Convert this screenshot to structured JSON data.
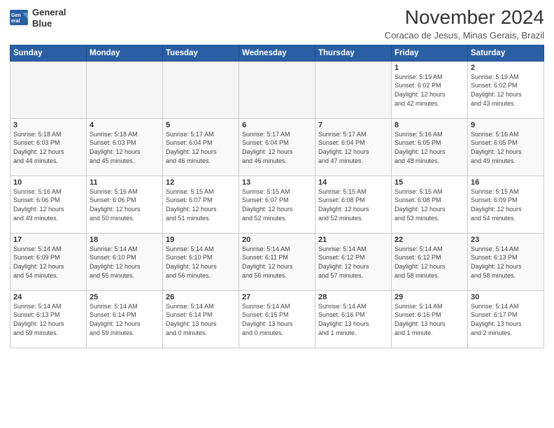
{
  "logo": {
    "line1": "General",
    "line2": "Blue"
  },
  "title": "November 2024",
  "subtitle": "Coracao de Jesus, Minas Gerais, Brazil",
  "days_of_week": [
    "Sunday",
    "Monday",
    "Tuesday",
    "Wednesday",
    "Thursday",
    "Friday",
    "Saturday"
  ],
  "weeks": [
    [
      {
        "day": "",
        "info": ""
      },
      {
        "day": "",
        "info": ""
      },
      {
        "day": "",
        "info": ""
      },
      {
        "day": "",
        "info": ""
      },
      {
        "day": "",
        "info": ""
      },
      {
        "day": "1",
        "info": "Sunrise: 5:19 AM\nSunset: 6:02 PM\nDaylight: 12 hours\nand 42 minutes."
      },
      {
        "day": "2",
        "info": "Sunrise: 5:19 AM\nSunset: 6:02 PM\nDaylight: 12 hours\nand 43 minutes."
      }
    ],
    [
      {
        "day": "3",
        "info": "Sunrise: 5:18 AM\nSunset: 6:03 PM\nDaylight: 12 hours\nand 44 minutes."
      },
      {
        "day": "4",
        "info": "Sunrise: 5:18 AM\nSunset: 6:03 PM\nDaylight: 12 hours\nand 45 minutes."
      },
      {
        "day": "5",
        "info": "Sunrise: 5:17 AM\nSunset: 6:04 PM\nDaylight: 12 hours\nand 46 minutes."
      },
      {
        "day": "6",
        "info": "Sunrise: 5:17 AM\nSunset: 6:04 PM\nDaylight: 12 hours\nand 46 minutes."
      },
      {
        "day": "7",
        "info": "Sunrise: 5:17 AM\nSunset: 6:04 PM\nDaylight: 12 hours\nand 47 minutes."
      },
      {
        "day": "8",
        "info": "Sunrise: 5:16 AM\nSunset: 6:05 PM\nDaylight: 12 hours\nand 48 minutes."
      },
      {
        "day": "9",
        "info": "Sunrise: 5:16 AM\nSunset: 6:05 PM\nDaylight: 12 hours\nand 49 minutes."
      }
    ],
    [
      {
        "day": "10",
        "info": "Sunrise: 5:16 AM\nSunset: 6:06 PM\nDaylight: 12 hours\nand 49 minutes."
      },
      {
        "day": "11",
        "info": "Sunrise: 5:16 AM\nSunset: 6:06 PM\nDaylight: 12 hours\nand 50 minutes."
      },
      {
        "day": "12",
        "info": "Sunrise: 5:15 AM\nSunset: 6:07 PM\nDaylight: 12 hours\nand 51 minutes."
      },
      {
        "day": "13",
        "info": "Sunrise: 5:15 AM\nSunset: 6:07 PM\nDaylight: 12 hours\nand 52 minutes."
      },
      {
        "day": "14",
        "info": "Sunrise: 5:15 AM\nSunset: 6:08 PM\nDaylight: 12 hours\nand 52 minutes."
      },
      {
        "day": "15",
        "info": "Sunrise: 5:15 AM\nSunset: 6:08 PM\nDaylight: 12 hours\nand 53 minutes."
      },
      {
        "day": "16",
        "info": "Sunrise: 5:15 AM\nSunset: 6:09 PM\nDaylight: 12 hours\nand 54 minutes."
      }
    ],
    [
      {
        "day": "17",
        "info": "Sunrise: 5:14 AM\nSunset: 6:09 PM\nDaylight: 12 hours\nand 54 minutes."
      },
      {
        "day": "18",
        "info": "Sunrise: 5:14 AM\nSunset: 6:10 PM\nDaylight: 12 hours\nand 55 minutes."
      },
      {
        "day": "19",
        "info": "Sunrise: 5:14 AM\nSunset: 6:10 PM\nDaylight: 12 hours\nand 56 minutes."
      },
      {
        "day": "20",
        "info": "Sunrise: 5:14 AM\nSunset: 6:11 PM\nDaylight: 12 hours\nand 56 minutes."
      },
      {
        "day": "21",
        "info": "Sunrise: 5:14 AM\nSunset: 6:12 PM\nDaylight: 12 hours\nand 57 minutes."
      },
      {
        "day": "22",
        "info": "Sunrise: 5:14 AM\nSunset: 6:12 PM\nDaylight: 12 hours\nand 58 minutes."
      },
      {
        "day": "23",
        "info": "Sunrise: 5:14 AM\nSunset: 6:13 PM\nDaylight: 12 hours\nand 58 minutes."
      }
    ],
    [
      {
        "day": "24",
        "info": "Sunrise: 5:14 AM\nSunset: 6:13 PM\nDaylight: 12 hours\nand 59 minutes."
      },
      {
        "day": "25",
        "info": "Sunrise: 5:14 AM\nSunset: 6:14 PM\nDaylight: 12 hours\nand 59 minutes."
      },
      {
        "day": "26",
        "info": "Sunrise: 5:14 AM\nSunset: 6:14 PM\nDaylight: 13 hours\nand 0 minutes."
      },
      {
        "day": "27",
        "info": "Sunrise: 5:14 AM\nSunset: 6:15 PM\nDaylight: 13 hours\nand 0 minutes."
      },
      {
        "day": "28",
        "info": "Sunrise: 5:14 AM\nSunset: 6:16 PM\nDaylight: 13 hours\nand 1 minute."
      },
      {
        "day": "29",
        "info": "Sunrise: 5:14 AM\nSunset: 6:16 PM\nDaylight: 13 hours\nand 1 minute."
      },
      {
        "day": "30",
        "info": "Sunrise: 5:14 AM\nSunset: 6:17 PM\nDaylight: 13 hours\nand 2 minutes."
      }
    ]
  ],
  "colors": {
    "header_bg": "#2a5fa5",
    "header_text": "#ffffff",
    "border": "#cccccc"
  }
}
